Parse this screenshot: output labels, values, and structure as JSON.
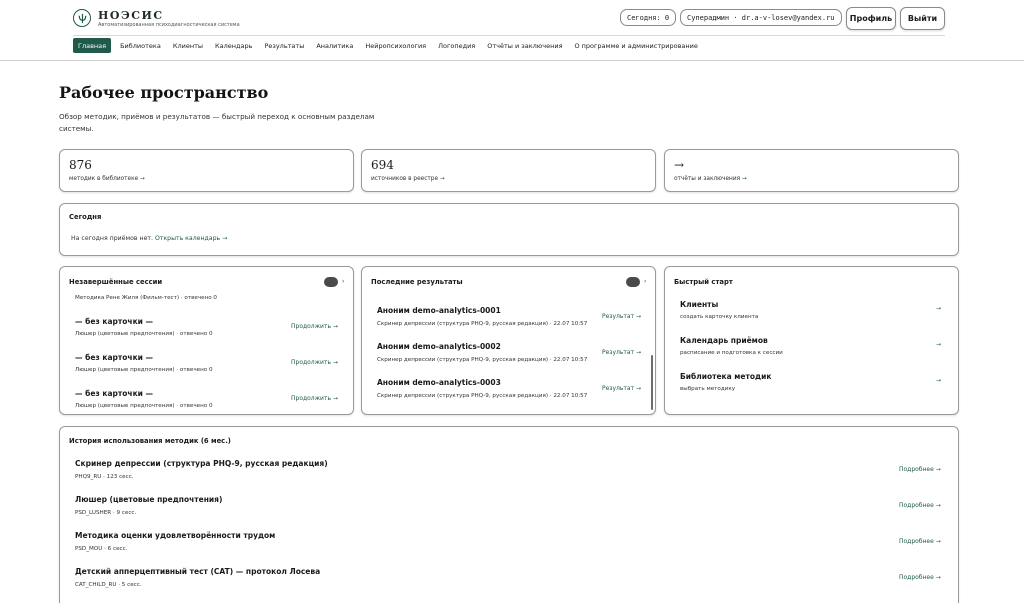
{
  "header": {
    "brand": "НОЭСИС",
    "subtitle": "Автоматизированная психодиагностическая система",
    "today": "Сегодня: 0",
    "user": "Суперадмин · dr.a-v-losev@yandex.ru",
    "profile": "Профиль",
    "logout": "Выйти"
  },
  "nav": [
    {
      "label": "Главная",
      "active": true
    },
    {
      "label": "Библиотека"
    },
    {
      "label": "Клиенты"
    },
    {
      "label": "Календарь"
    },
    {
      "label": "Результаты"
    },
    {
      "label": "Аналитика"
    },
    {
      "label": "Нейропсихология"
    },
    {
      "label": "Логопедия"
    },
    {
      "label": "Отчёты и заключения"
    },
    {
      "label": "О программе и администрирование"
    }
  ],
  "page": {
    "title": "Рабочее пространство",
    "description": "Обзор методик, приёмов и результатов — быстрый переход к основным разделам системы."
  },
  "stats": [
    {
      "value": "876",
      "label": "методик в библиотеке",
      "arrow": "→"
    },
    {
      "value": "694",
      "label": "источников в реестре",
      "arrow": "→"
    },
    {
      "value": "→",
      "label": "отчёты и заключения",
      "arrow": "→"
    }
  ],
  "today": {
    "title": "Сегодня",
    "text": "На сегодня приёмов нет.",
    "link": "Открыть календарь →"
  },
  "sessions": {
    "title": "Незавершённые сессии",
    "top_partial": "Методика Рене Жиля (Фильм-тест) · отвечено 0",
    "items": [
      {
        "title": "— без карточки —",
        "sub": "Люшер (цветовые предпочтения) · отвечено 0",
        "action": "Продолжить →"
      },
      {
        "title": "— без карточки —",
        "sub": "Люшер (цветовые предпочтения) · отвечено 0",
        "action": "Продолжить →"
      },
      {
        "title": "— без карточки —",
        "sub": "Люшер (цветовые предпочтения) · отвечено 0",
        "action": "Продолжить →"
      }
    ]
  },
  "results": {
    "title": "Последние результаты",
    "items": [
      {
        "title": "Аноним demo-analytics-0001",
        "sub": "Скринер депрессии (структура PHQ-9, русская редакция) · 22.07 10:57",
        "action": "Результат →"
      },
      {
        "title": "Аноним demo-analytics-0002",
        "sub": "Скринер депрессии (структура PHQ-9, русская редакция) · 22.07 10:57",
        "action": "Результат →"
      },
      {
        "title": "Аноним demo-analytics-0003",
        "sub": "Скринер депрессии (структура PHQ-9, русская редакция) · 22.07 10:57",
        "action": "Результат →"
      }
    ]
  },
  "quick": {
    "title": "Быстрый старт",
    "items": [
      {
        "title": "Клиенты",
        "sub": "создать карточку клиента",
        "action": "→"
      },
      {
        "title": "Календарь приёмов",
        "sub": "расписание и подготовка к сессии",
        "action": "→"
      },
      {
        "title": "Библиотека методик",
        "sub": "выбрать методику",
        "action": "→"
      }
    ]
  },
  "history": {
    "title": "История использования методик (6 мес.)",
    "items": [
      {
        "title": "Скринер депрессии (структура PHQ-9, русская редакция)",
        "sub": "PHQ9_RU · 123 сесс.",
        "action": "Подробнее →"
      },
      {
        "title": "Люшер (цветовые предпочтения)",
        "sub": "PSD_LUSHER · 9 сесс.",
        "action": "Подробнее →"
      },
      {
        "title": "Методика оценки удовлетворённости трудом",
        "sub": "PSD_MOU · 6 сесс.",
        "action": "Подробнее →"
      },
      {
        "title": "Детский апперцептивный тест (CAT) — протокол Лосева",
        "sub": "CAT_CHILD_RU · 5 сесс.",
        "action": "Подробнее →"
      }
    ]
  }
}
